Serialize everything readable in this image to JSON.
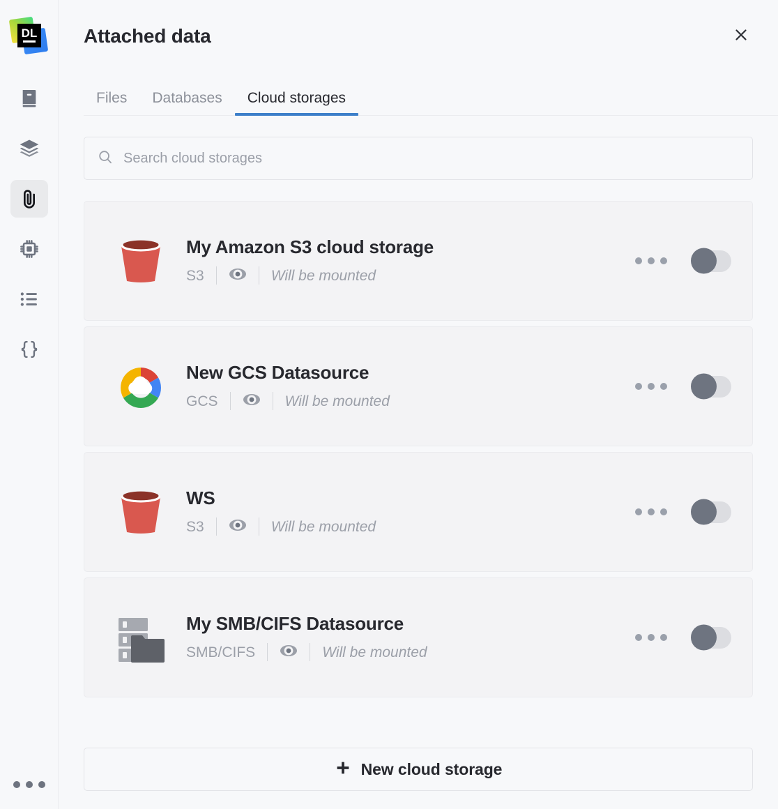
{
  "app": {
    "logo_text": "DL",
    "logo_name": "datalore-logo"
  },
  "sidebar": {
    "items": [
      {
        "icon": "notebook-icon",
        "name": "notebook",
        "active": false
      },
      {
        "icon": "layers-icon",
        "name": "layers",
        "active": false
      },
      {
        "icon": "paperclip-icon",
        "name": "attached-data",
        "active": true
      },
      {
        "icon": "chip-icon",
        "name": "compute",
        "active": false
      },
      {
        "icon": "list-icon",
        "name": "outline",
        "active": false
      },
      {
        "icon": "braces-icon",
        "name": "variables",
        "active": false
      }
    ],
    "bottom_menu_icon": "more-horizontal-icon"
  },
  "header": {
    "title": "Attached data",
    "close_icon": "close-icon"
  },
  "tabs": [
    {
      "label": "Files",
      "active": false
    },
    {
      "label": "Databases",
      "active": false
    },
    {
      "label": "Cloud storages",
      "active": true
    }
  ],
  "search": {
    "icon": "search-icon",
    "value": "",
    "placeholder": "Search cloud storages"
  },
  "storages": [
    {
      "name": "My Amazon S3 cloud storage",
      "type": "S3",
      "icon": "s3-bucket-icon",
      "visibility_icon": "eye-icon",
      "status": "Will be mounted",
      "mounted": false
    },
    {
      "name": "New GCS Datasource",
      "type": "GCS",
      "icon": "google-cloud-icon",
      "visibility_icon": "eye-icon",
      "status": "Will be mounted",
      "mounted": false
    },
    {
      "name": "WS",
      "type": "S3",
      "icon": "s3-bucket-icon",
      "visibility_icon": "eye-icon",
      "status": "Will be mounted",
      "mounted": false
    },
    {
      "name": "My SMB/CIFS Datasource",
      "type": "SMB/CIFS",
      "icon": "smb-share-icon",
      "visibility_icon": "eye-icon",
      "status": "Will be mounted",
      "mounted": false
    }
  ],
  "footer": {
    "new_storage_label": "New cloud storage",
    "new_storage_icon": "plus-icon"
  },
  "colors": {
    "accent": "#3d7fc9",
    "page_bg": "#f7f8fa",
    "card_bg": "#f3f3f5",
    "text_primary": "#27282e",
    "text_muted": "#9b9fa8",
    "s3_red": "#d9584f",
    "s3_rim": "#8b3228",
    "gcp_red": "#db4437",
    "gcp_blue": "#4285f4",
    "gcp_yellow": "#f4b400",
    "gcp_green": "#34a853",
    "toggle_knob": "#6e7480",
    "toggle_track": "#dcdde1"
  }
}
